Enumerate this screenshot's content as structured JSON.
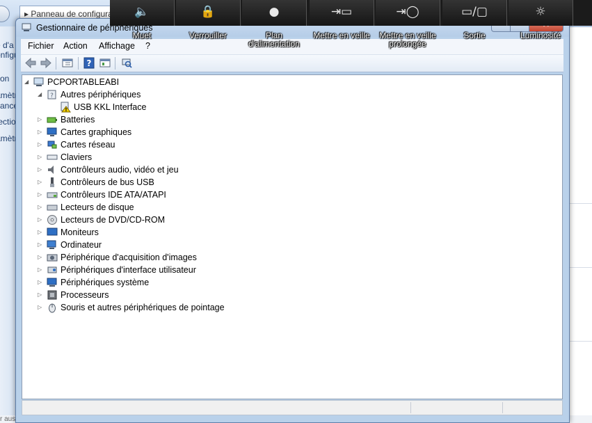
{
  "background": {
    "breadcrumb": "▸ Panneau de configuration ▸ Système et sécurité ▸ Système",
    "left_pane": [
      "e d'a",
      "onfigu",
      "tion",
      "amètr",
      "vance",
      "tectio",
      "amètr"
    ],
    "bottom_text": "r aussi"
  },
  "overlay": {
    "buttons": [
      {
        "label": "Muet",
        "icon": "mute-speaker-icon",
        "glyph": "🔈"
      },
      {
        "label": "Verrouiller",
        "icon": "lock-icon",
        "glyph": "🔒"
      },
      {
        "label": "Plan d'alimentation",
        "icon": "power-plan-icon",
        "glyph": "●"
      },
      {
        "label": "Mettre en veille",
        "icon": "sleep-icon",
        "glyph": "⇥▭"
      },
      {
        "label": "Mettre en veille prolongée",
        "icon": "hibernate-icon",
        "glyph": "⇥◯"
      },
      {
        "label": "Sortie",
        "icon": "display-output-icon",
        "glyph": "▭/▢"
      },
      {
        "label": "Luminosité",
        "icon": "brightness-icon",
        "glyph": "☼"
      }
    ]
  },
  "window": {
    "title": "Gestionnaire de périphériques",
    "close_glyph": "✕"
  },
  "menu": {
    "items": [
      "Fichier",
      "Action",
      "Affichage",
      "?"
    ]
  },
  "toolbar": {
    "buttons": [
      "back-arrow-icon",
      "forward-arrow-icon",
      "properties-icon",
      "help-icon",
      "view-icon",
      "scan-hardware-icon"
    ]
  },
  "tree": {
    "root": "PCPORTABLEABI",
    "autres": {
      "label": "Autres périphériques",
      "child": "USB KKL Interface"
    },
    "categories": [
      "Batteries",
      "Cartes graphiques",
      "Cartes réseau",
      "Claviers",
      "Contrôleurs audio, vidéo et jeu",
      "Contrôleurs de bus USB",
      "Contrôleurs IDE ATA/ATAPI",
      "Lecteurs de disque",
      "Lecteurs de DVD/CD-ROM",
      "Moniteurs",
      "Ordinateur",
      "Périphérique d'acquisition d'images",
      "Périphériques d'interface utilisateur",
      "Périphériques système",
      "Processeurs",
      "Souris et autres périphériques de pointage"
    ]
  },
  "colors": {
    "window_frame": "#b9d1ea",
    "overlay_bar": "#1b1b1b",
    "close_button": "#c4432f"
  }
}
